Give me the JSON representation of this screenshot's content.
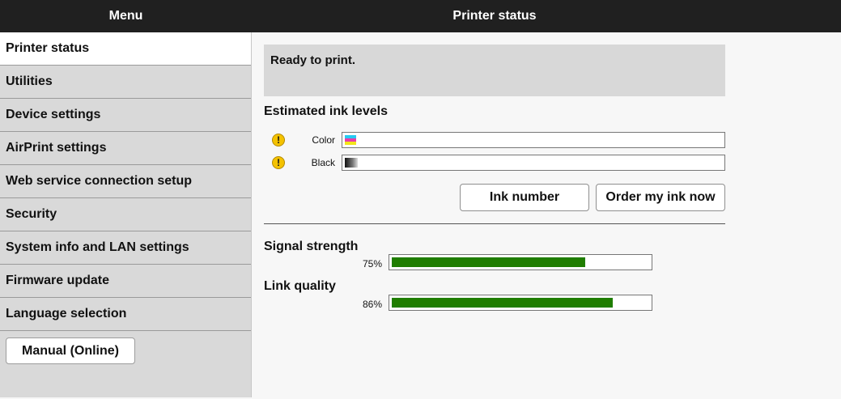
{
  "header": {
    "menu_title": "Menu",
    "page_title": "Printer status"
  },
  "sidebar": {
    "items": [
      {
        "label": "Printer status",
        "active": true
      },
      {
        "label": "Utilities"
      },
      {
        "label": "Device settings"
      },
      {
        "label": "AirPrint settings"
      },
      {
        "label": "Web service connection setup"
      },
      {
        "label": "Security"
      },
      {
        "label": "System info and LAN settings"
      },
      {
        "label": "Firmware update"
      },
      {
        "label": "Language selection"
      }
    ],
    "manual_button": "Manual (Online)"
  },
  "status": {
    "message": "Ready to print."
  },
  "ink": {
    "heading": "Estimated ink levels",
    "items": [
      {
        "label": "Color",
        "icon": "warning-icon",
        "level_fraction": 0.03
      },
      {
        "label": "Black",
        "icon": "warning-icon",
        "level_fraction": 0.035
      }
    ],
    "warning_glyph": "!",
    "ink_number_button": "Ink number",
    "order_button": "Order my ink now"
  },
  "signal": {
    "heading": "Signal strength",
    "percent_text": "75%",
    "value": 75,
    "color": "#1f7d00"
  },
  "link": {
    "heading": "Link quality",
    "percent_text": "86%",
    "value": 86,
    "color": "#1f7d00"
  }
}
